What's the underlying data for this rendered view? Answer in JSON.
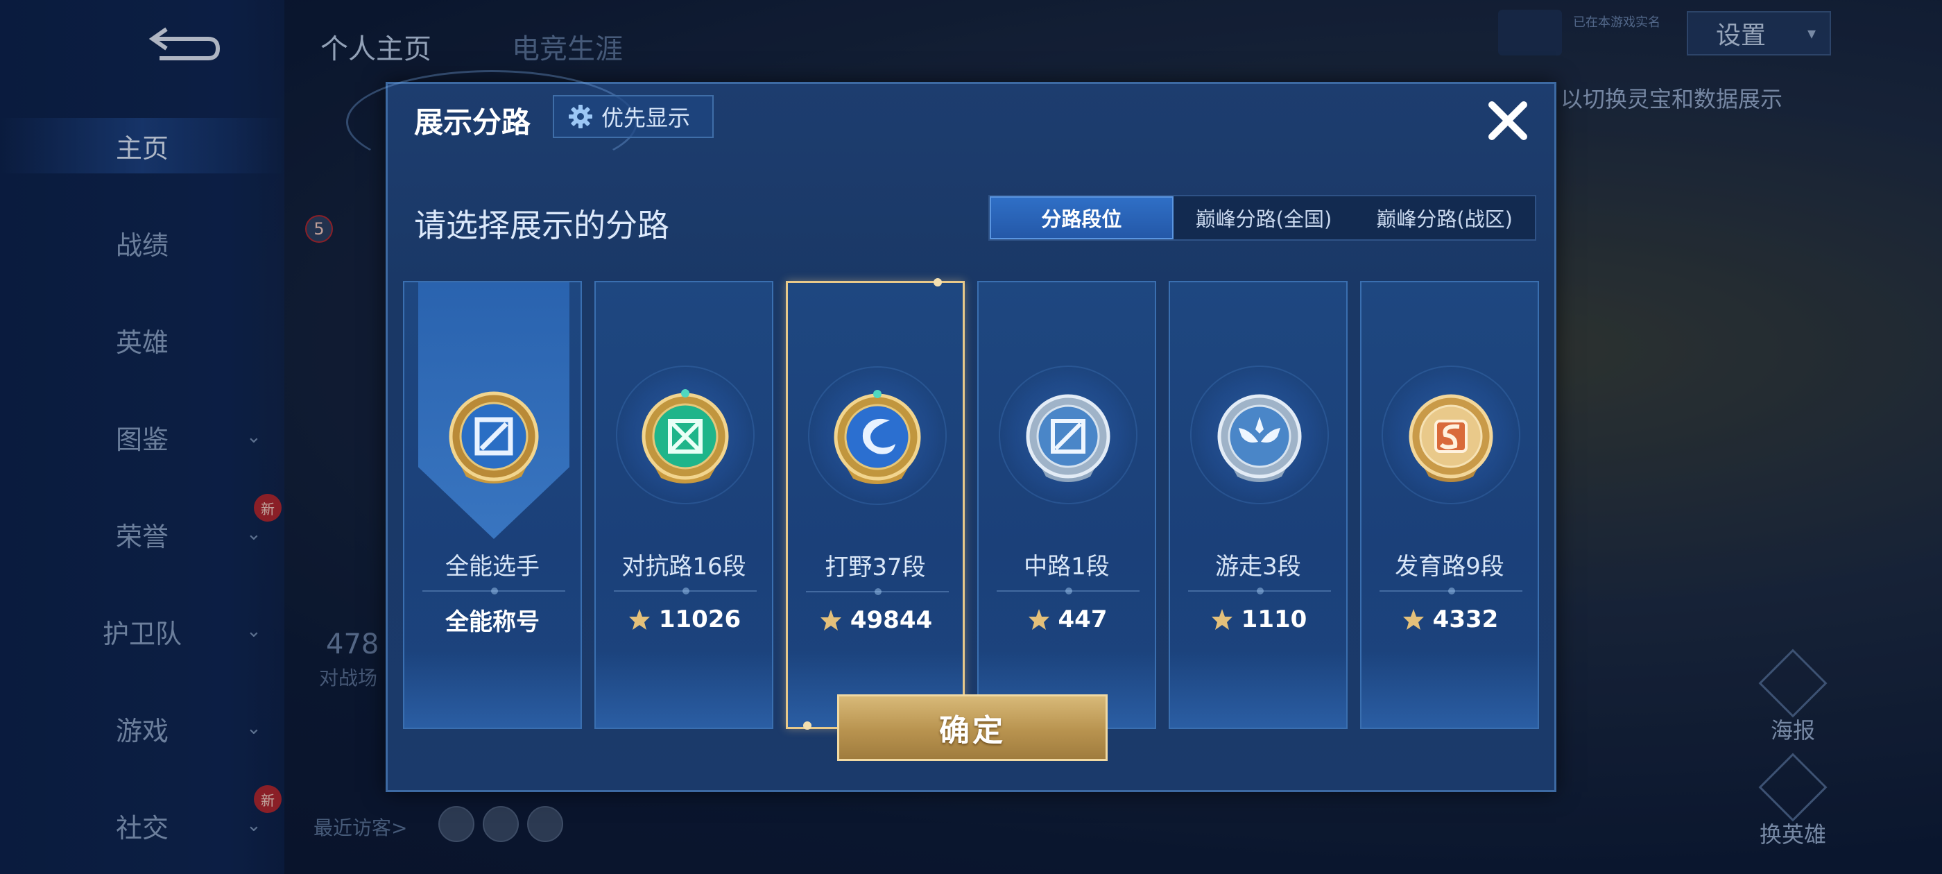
{
  "background": {
    "sidebar": {
      "items": [
        {
          "label": "主页",
          "active": true
        },
        {
          "label": "战绩"
        },
        {
          "label": "英雄"
        },
        {
          "label": "图鉴",
          "chevron": true
        },
        {
          "label": "荣誉",
          "chevron": true,
          "badge": "新"
        },
        {
          "label": "护卫队",
          "chevron": true
        },
        {
          "label": "游戏",
          "chevron": true
        },
        {
          "label": "社交",
          "chevron": true,
          "badge": "新"
        }
      ],
      "notification_count": "5"
    },
    "top_tabs": [
      "个人主页",
      "电竞生涯"
    ],
    "settings_label": "设置",
    "small_tag": "已在本游戏实名",
    "hint": "以切换灵宝和数据展示",
    "stat_number": "478",
    "stat_sub": "对战场",
    "recent_visitors_label": "最近访客>",
    "right_actions": [
      "海报",
      "换英雄"
    ]
  },
  "modal": {
    "title": "展示分路",
    "priority_button": "优先显示",
    "section_label": "请选择展示的分路",
    "tabs": [
      {
        "label": "分路段位",
        "active": true
      },
      {
        "label": "巅峰分路(全国)"
      },
      {
        "label": "巅峰分路(战区)"
      }
    ],
    "cards": [
      {
        "lane": "全能选手",
        "value": "全能称号",
        "emblem": "all-round-emblem",
        "has_score_icon": false
      },
      {
        "lane": "对抗路16段",
        "value": "11026",
        "emblem": "clash-lane-emblem",
        "has_score_icon": true
      },
      {
        "lane": "打野37段",
        "value": "49844",
        "emblem": "jungle-emblem",
        "has_score_icon": true,
        "selected": true
      },
      {
        "lane": "中路1段",
        "value": "447",
        "emblem": "mid-lane-emblem",
        "has_score_icon": true
      },
      {
        "lane": "游走3段",
        "value": "1110",
        "emblem": "roam-emblem",
        "has_score_icon": true
      },
      {
        "lane": "发育路9段",
        "value": "4332",
        "emblem": "farm-lane-emblem",
        "has_score_icon": true
      }
    ],
    "confirm_label": "确定"
  },
  "colors": {
    "accent_gold": "#d8b978",
    "active_tab": "#2f6fc6",
    "modal_bg": "#1b3a6b",
    "selected_border": "#e8c98a"
  }
}
